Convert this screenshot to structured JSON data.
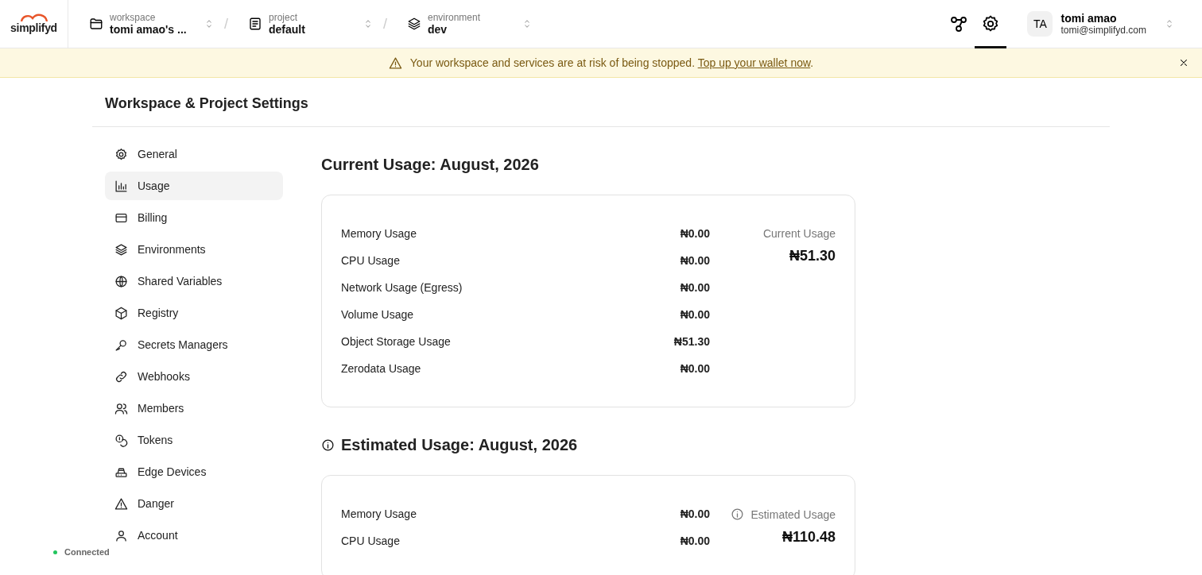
{
  "header": {
    "logo": "simplifyd",
    "selectors": [
      {
        "label": "workspace",
        "value": "tomi amao's ..."
      },
      {
        "label": "project",
        "value": "default"
      },
      {
        "label": "environment",
        "value": "dev"
      }
    ],
    "separators": [
      "/",
      "/"
    ],
    "tools": [
      {
        "selected": false
      },
      {
        "selected": true
      }
    ],
    "user": {
      "initials": "TA",
      "name": "tomi amao",
      "email": "tomi@simplifyd.com"
    }
  },
  "banner": {
    "message": "Your workspace and services are at risk of being stopped. ",
    "link": "Top up your wallet now",
    "end": "."
  },
  "page_title": "Workspace & Project Settings",
  "sidebar": {
    "items": [
      {
        "label": "General",
        "selected": false
      },
      {
        "label": "Usage",
        "selected": true
      },
      {
        "label": "Billing",
        "selected": false
      },
      {
        "label": "Environments",
        "selected": false
      },
      {
        "label": "Shared Variables",
        "selected": false
      },
      {
        "label": "Registry",
        "selected": false
      },
      {
        "label": "Secrets Managers",
        "selected": false
      },
      {
        "label": "Webhooks",
        "selected": false
      },
      {
        "label": "Members",
        "selected": false
      },
      {
        "label": "Tokens",
        "selected": false
      },
      {
        "label": "Edge Devices",
        "selected": false
      },
      {
        "label": "Danger",
        "selected": false
      },
      {
        "label": "Account",
        "selected": false
      }
    ]
  },
  "sections": [
    {
      "title": "Current Usage: August, 2026",
      "info": false,
      "rows": [
        {
          "label": "Memory Usage",
          "value": "₦0.00"
        },
        {
          "label": "CPU Usage",
          "value": "₦0.00"
        },
        {
          "label": "Network Usage (Egress)",
          "value": "₦0.00"
        },
        {
          "label": "Volume Usage",
          "value": "₦0.00"
        },
        {
          "label": "Object Storage Usage",
          "value": "₦51.30"
        },
        {
          "label": "Zerodata Usage",
          "value": "₦0.00"
        }
      ],
      "summary": {
        "label": "Current Usage",
        "value": "₦51.30",
        "info": false
      }
    },
    {
      "title": "Estimated Usage: August, 2026",
      "info": true,
      "rows": [
        {
          "label": "Memory Usage",
          "value": "₦0.00"
        },
        {
          "label": "CPU Usage",
          "value": "₦0.00"
        }
      ],
      "summary": {
        "label": "Estimated Usage",
        "value": "₦110.48",
        "info": true
      }
    }
  ],
  "status": {
    "label": "Connected",
    "connected": true
  }
}
